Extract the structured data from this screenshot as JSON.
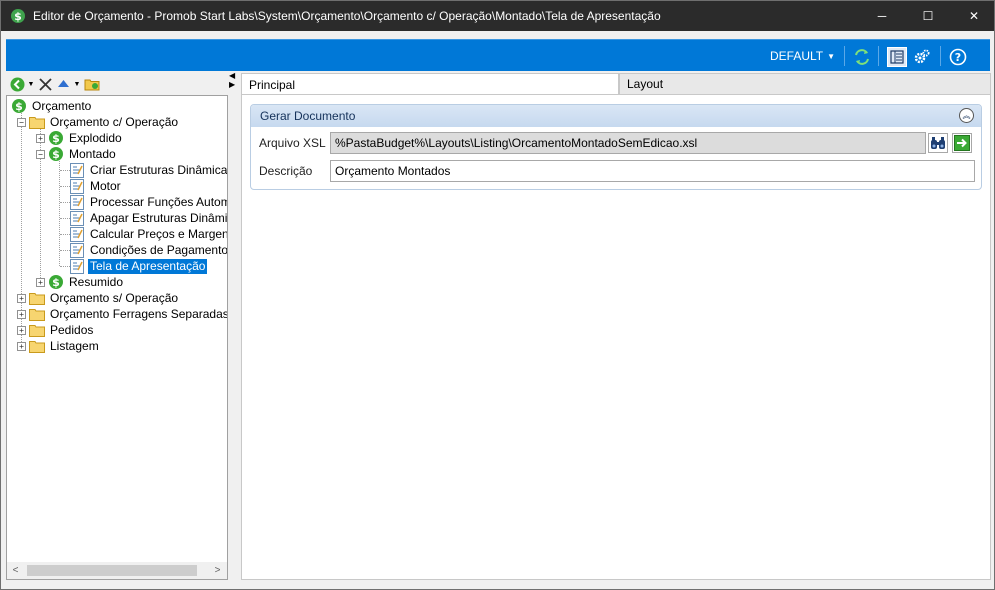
{
  "window": {
    "title": "Editor de Orçamento - Promob Start Labs\\System\\Orçamento\\Orçamento c/ Operação\\Montado\\Tela de Apresentação",
    "minimize": "─",
    "maximize": "☐",
    "close": "✕"
  },
  "toolbar": {
    "profile_label": "DEFAULT",
    "profile_caret": "▼",
    "icons": [
      "refresh-icon",
      "layout-panel-icon",
      "settings-icon",
      "help-icon"
    ]
  },
  "left_toolbar": {
    "icons": [
      "back-icon",
      "dropdown-caret-icon",
      "delete-icon",
      "move-up-icon",
      "dropdown-caret-icon",
      "folder-open-icon"
    ]
  },
  "tree": {
    "items": [
      {
        "label": "Orçamento",
        "icon": "budget-dollar-icon"
      },
      {
        "label": "Orçamento c/ Operação",
        "icon": "folder-icon",
        "expander": "−"
      },
      {
        "label": "Explodido",
        "icon": "budget-dollar-icon",
        "expander": "+"
      },
      {
        "label": "Montado",
        "icon": "budget-dollar-icon",
        "expander": "−"
      },
      {
        "label": "Criar Estruturas Dinâmicas",
        "icon": "document-icon"
      },
      {
        "label": "Motor",
        "icon": "document-icon"
      },
      {
        "label": "Processar Funções Automá",
        "icon": "document-icon"
      },
      {
        "label": "Apagar Estruturas Dinâmica",
        "icon": "document-icon"
      },
      {
        "label": "Calcular Preços e Margens",
        "icon": "document-icon"
      },
      {
        "label": "Condições de Pagamento",
        "icon": "document-icon"
      },
      {
        "label": "Tela de Apresentação",
        "icon": "document-icon",
        "selected": true
      },
      {
        "label": "Resumido",
        "icon": "budget-dollar-icon",
        "expander": "+"
      },
      {
        "label": "Orçamento s/ Operação",
        "icon": "folder-icon",
        "expander": "+"
      },
      {
        "label": "Orçamento Ferragens Separadas",
        "icon": "folder-icon",
        "expander": "+"
      },
      {
        "label": "Pedidos",
        "icon": "folder-icon",
        "expander": "+"
      },
      {
        "label": "Listagem",
        "icon": "folder-icon",
        "expander": "+"
      }
    ],
    "scroll_left": "<",
    "scroll_right": ">"
  },
  "splitter": {
    "up": "◀",
    "down": "▶"
  },
  "tabs": [
    {
      "label": "Principal",
      "active": true
    },
    {
      "label": "Layout",
      "active": false
    }
  ],
  "group": {
    "title": "Gerar Documento",
    "collapse_symbol": "︽",
    "xsl_label": "Arquivo XSL",
    "xsl_value": "%PastaBudget%\\Layouts\\Listing\\OrcamentoMontadoSemEdicao.xsl",
    "desc_label": "Descrição",
    "desc_value": "Orçamento Montados"
  },
  "colors": {
    "accent": "#0078d7",
    "titlebar": "#2b2b2b",
    "selection": "#0078d7",
    "group_header": "#c6d9ef"
  }
}
